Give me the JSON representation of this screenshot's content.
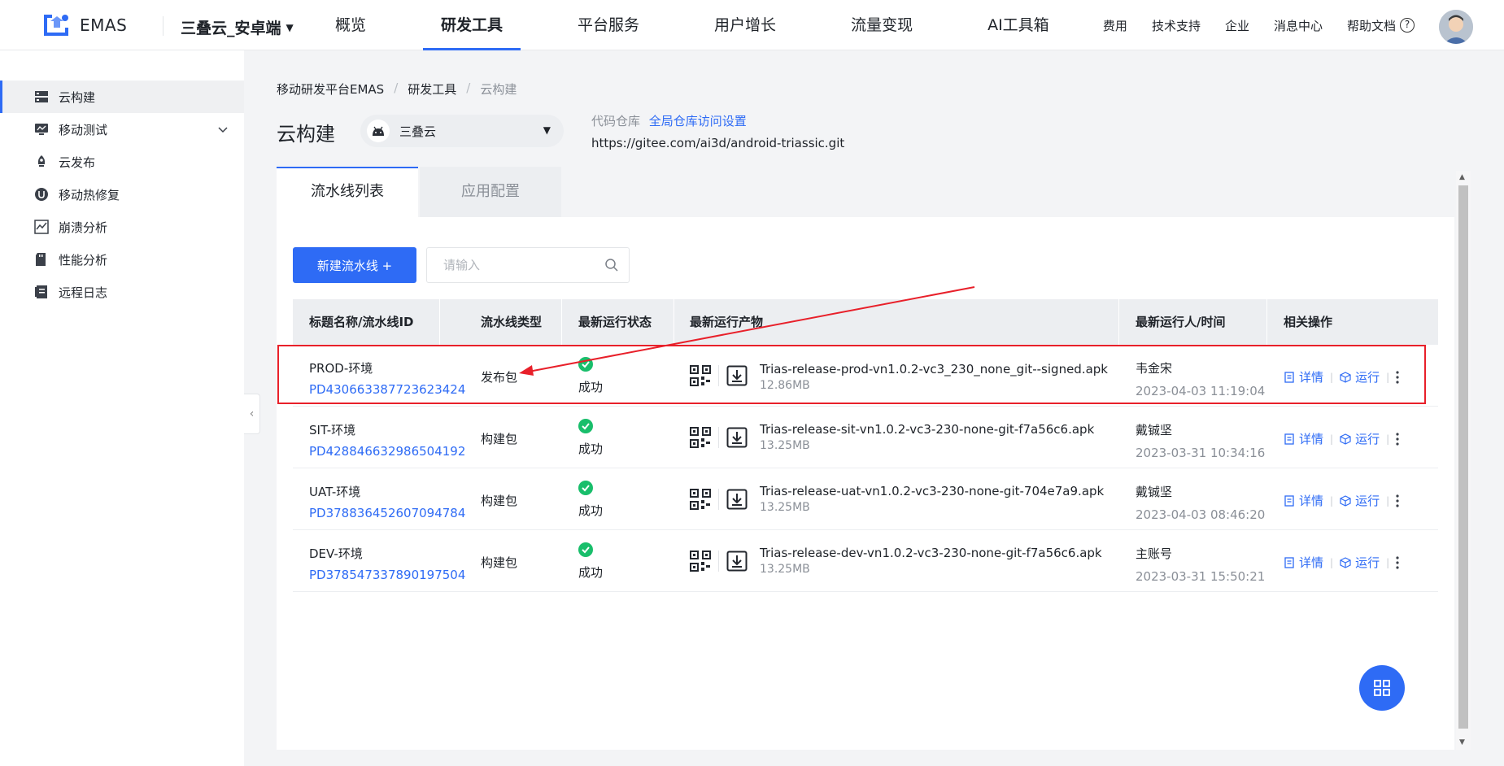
{
  "header": {
    "logo_text": "EMAS",
    "app_switcher": "三叠云_安卓端",
    "nav": [
      "概览",
      "研发工具",
      "平台服务",
      "用户增长",
      "流量变现",
      "AI工具箱"
    ],
    "active_nav_index": 1,
    "right_links": [
      "费用",
      "技术支持",
      "企业",
      "消息中心",
      "帮助文档"
    ],
    "accent_color": "#2e6bf5"
  },
  "sidebar": {
    "items": [
      {
        "label": "云构建",
        "icon": "server-icon",
        "active": true
      },
      {
        "label": "移动测试",
        "icon": "monitor-icon",
        "expandable": true
      },
      {
        "label": "云发布",
        "icon": "rocket-icon"
      },
      {
        "label": "移动热修复",
        "icon": "hotfix-icon"
      },
      {
        "label": "崩溃分析",
        "icon": "crash-chart-icon"
      },
      {
        "label": "性能分析",
        "icon": "sd-card-icon"
      },
      {
        "label": "远程日志",
        "icon": "log-icon"
      }
    ]
  },
  "breadcrumb": [
    "移动研发平台EMAS",
    "研发工具",
    "云构建"
  ],
  "page": {
    "title": "云构建",
    "app_select": "三叠云",
    "repo_label": "代码仓库",
    "repo_link": "全局仓库访问设置",
    "repo_url": "https://gitee.com/ai3d/android-triassic.git"
  },
  "tabs": [
    "流水线列表",
    "应用配置"
  ],
  "toolbar": {
    "new_pipeline": "新建流水线 +",
    "search_placeholder": "请输入"
  },
  "table": {
    "columns": [
      "标题名称/流水线ID",
      "流水线类型",
      "最新运行状态",
      "最新运行产物",
      "最新运行人/时间",
      "相关操作"
    ],
    "rows": [
      {
        "name": "PROD-环境",
        "id": "PD430663387723623424",
        "type": "发布包",
        "status": "成功",
        "product": "Trias-release-prod-vn1.0.2-vc3_230_none_git--signed.apk",
        "size": "12.86MB",
        "runner": "韦金宋",
        "time": "2023-04-03 11:19:04"
      },
      {
        "name": "SIT-环境",
        "id": "PD428846632986504192",
        "type": "构建包",
        "status": "成功",
        "product": "Trias-release-sit-vn1.0.2-vc3-230-none-git-f7a56c6.apk",
        "size": "13.25MB",
        "runner": "戴铖坚",
        "time": "2023-03-31 10:34:16"
      },
      {
        "name": "UAT-环境",
        "id": "PD378836452607094784",
        "type": "构建包",
        "status": "成功",
        "product": "Trias-release-uat-vn1.0.2-vc3-230-none-git-704e7a9.apk",
        "size": "13.25MB",
        "runner": "戴铖坚",
        "time": "2023-04-03 08:46:20"
      },
      {
        "name": "DEV-环境",
        "id": "PD378547337890197504",
        "type": "构建包",
        "status": "成功",
        "product": "Trias-release-dev-vn1.0.2-vc3-230-none-git-f7a56c6.apk",
        "size": "13.25MB",
        "runner": "主账号",
        "time": "2023-03-31 15:50:21"
      }
    ],
    "actions": {
      "detail": "详情",
      "run": "运行"
    }
  },
  "colors": {
    "success": "#19be6b",
    "annotation": "#e8202a",
    "link": "#2e6bf5"
  }
}
